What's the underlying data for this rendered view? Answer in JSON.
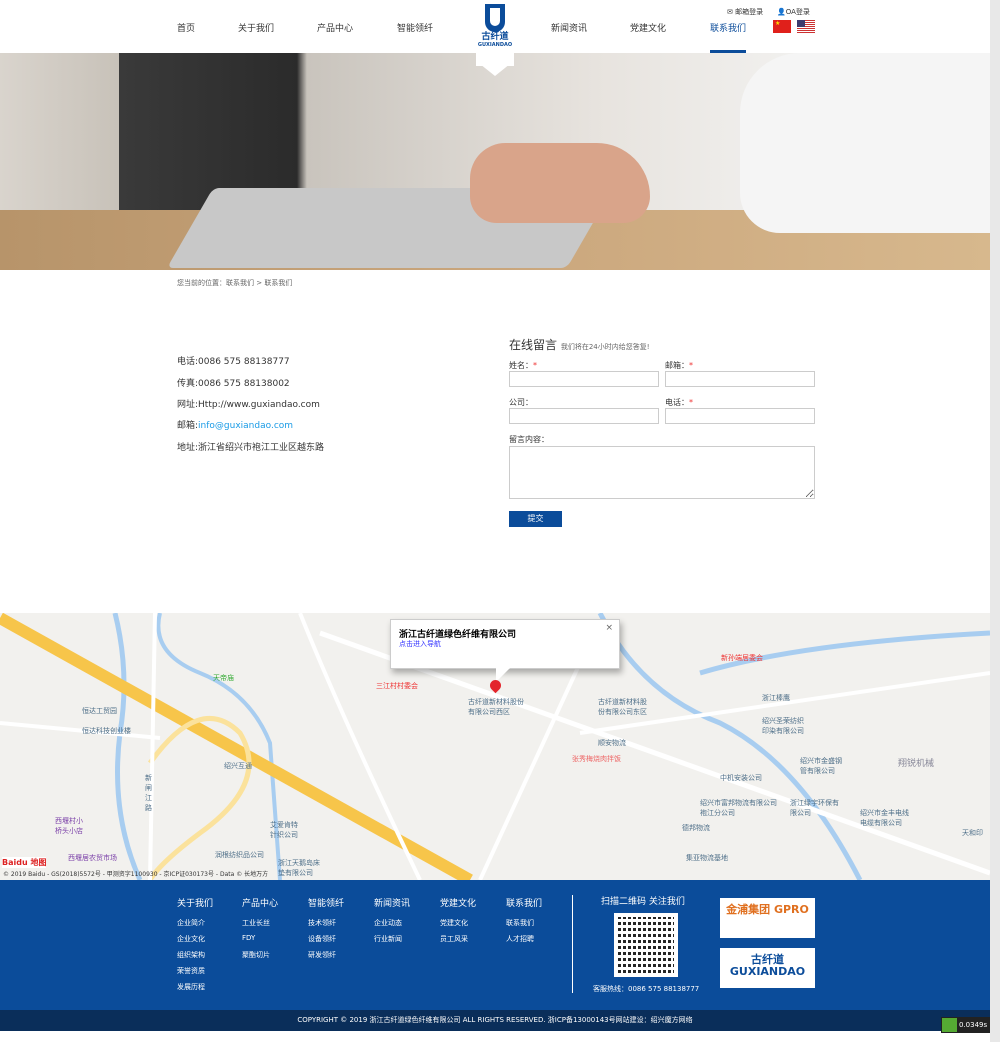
{
  "header": {
    "nav_left": [
      "首页",
      "关于我们",
      "产品中心",
      "智能领纤"
    ],
    "nav_right": [
      "新闻资讯",
      "党建文化",
      "联系我们"
    ],
    "active": "联系我们",
    "logo_text": "古纤道",
    "logo_sub": "GUXIANDAO",
    "logo_mark": "GXD",
    "mail_login": "邮箱登录",
    "oa_login": "OA登录",
    "flags": [
      "cn-flag",
      "us-flag"
    ]
  },
  "breadcrumb": "您当前的位置：联系我们 > 联系我们",
  "contact": {
    "phone": "电话:0086 575 88138777",
    "fax": "传真:0086 575 88138002",
    "web": "网址:Http://www.guxiandao.com",
    "email_label": "邮箱:",
    "email": "info@guxiandao.com",
    "address": "地址:浙江省绍兴市袍江工业区越东路"
  },
  "form": {
    "title": "在线留言",
    "subtitle": "我们将在24小时内给您答复!",
    "name": "姓名：",
    "email": "邮箱：",
    "company": "公司：",
    "phone": "电话：",
    "message": "留言内容：",
    "required": "*",
    "submit": "提交"
  },
  "map": {
    "popup_title": "浙江古纤道绿色纤维有限公司",
    "popup_link": "点击进入导航",
    "close": "×",
    "labels": [
      "三江村村委会",
      "古纤道新材料股份有限公司西区",
      "古纤道新材料股份有限公司东区",
      "顺安物流",
      "张秀梅烧肉拌饭",
      "恒达工贸园",
      "恒达科技创业楼",
      "绍兴互通",
      "天帝庙",
      "新闸江路",
      "西堰村小桥头小店",
      "西堰居农贸市场",
      "艾爱肯特针织公司",
      "润根纺织品公司",
      "浙江天鹅岛床垫有限公司",
      "新孙端居委会",
      "浙江棒鹰",
      "绍兴圣荣纺织印染有限公司",
      "绍兴市金盛钢管有限公司",
      "中机安装公司",
      "绍兴市富邦物流有限公司袍江分公司",
      "德邦物流",
      "集亚物流基地",
      "浙江绿宇环保有限公司",
      "绍兴市金丰电线电缆有限公司",
      "翔锐机械",
      "天和印"
    ],
    "baidu": "Baidu 地图",
    "copyright": "© 2019 Baidu - GS(2018)5572号 - 甲测资字1100930 - 京ICP证030173号 - Data © 长地万方"
  },
  "footer": {
    "columns": [
      {
        "title": "关于我们",
        "items": [
          "企业简介",
          "企业文化",
          "组织架构",
          "荣誉资质",
          "发展历程"
        ]
      },
      {
        "title": "产品中心",
        "items": [
          "工业长丝",
          "FDY",
          "聚酯切片"
        ]
      },
      {
        "title": "智能领纤",
        "items": [
          "技术领纤",
          "设备领纤",
          "研发领纤"
        ]
      },
      {
        "title": "新闻资讯",
        "items": [
          "企业动态",
          "行业新闻"
        ]
      },
      {
        "title": "党建文化",
        "items": [
          "党建文化",
          "员工风采"
        ]
      },
      {
        "title": "联系我们",
        "items": [
          "联系我们",
          "人才招聘"
        ]
      }
    ],
    "qr_title": "扫描二维码 关注我们",
    "hotline": "客服热线：0086 575 88138777",
    "brands": [
      "金浦集团 GPRO",
      "古纤道 GUXIANDAO"
    ],
    "copyright": "COPYRIGHT © 2019 浙江古纤道绿色纤维有限公司 ALL RIGHTS RESERVED. 浙ICP备13000143号网站建设：绍兴魔方网络",
    "timer": "0.0349s"
  },
  "colors": {
    "brand": "#0b4c9a",
    "footer_bar": "#0a2e5a",
    "link": "#1a9be6",
    "required": "#e33"
  }
}
